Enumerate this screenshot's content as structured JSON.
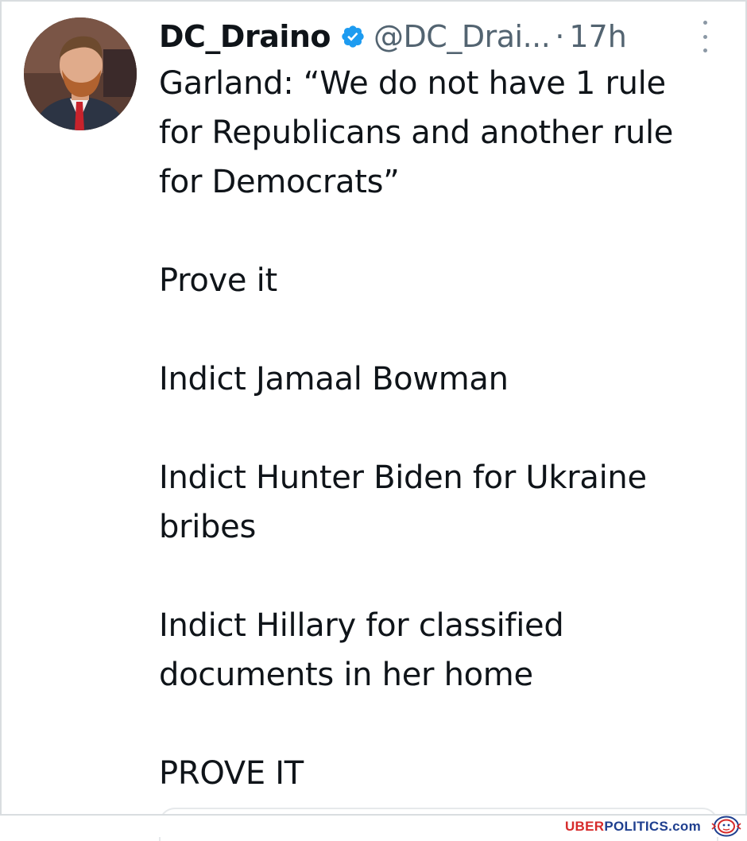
{
  "tweet": {
    "author_name": "DC_Draino",
    "handle": "@DC_Drai...",
    "separator": "·",
    "time": "17h",
    "lines": [
      "Garland: “We do not have 1 rule",
      "for Republicans and another rule",
      "for Democrats”",
      "Prove it",
      "Indict Jamaal Bowman",
      "Indict Hunter Biden for Ukraine",
      "bribes",
      "Indict Hillary for classified",
      "documents in her home",
      "PROVE IT"
    ]
  },
  "icons": {
    "verified": "verified-badge-icon",
    "more": "more-options-icon"
  },
  "colors": {
    "verified": "#1d9bf0",
    "secondary_text": "#536471",
    "watermark_red": "#d62b2b",
    "watermark_blue": "#1f3f8f"
  },
  "watermark": {
    "part1": "UBER",
    "part2": "POLITICS.com"
  }
}
